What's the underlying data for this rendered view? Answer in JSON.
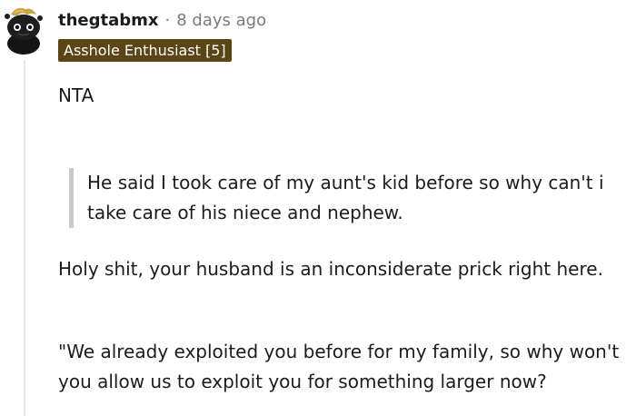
{
  "comment": {
    "username": "thegtabmx",
    "separator": "·",
    "timestamp": "8 days ago",
    "flair": "Asshole Enthusiast [5]",
    "verdict": "NTA",
    "quote": "He said I took care of my aunt's kid before so why can't i take care of his niece and nephew.",
    "paragraph1": "Holy shit, your husband is an inconsiderate prick right here.",
    "paragraph2": "\"We already exploited you before for my family, so why won't you allow us to exploit you for something larger now?"
  },
  "colors": {
    "flair_bg": "#5b4416",
    "meta_text": "#7c7c7c",
    "quote_bar": "#c8c8c8",
    "thread_line": "#e3e3e3"
  },
  "icons": {
    "avatar": "snoo-avatar-icon"
  }
}
